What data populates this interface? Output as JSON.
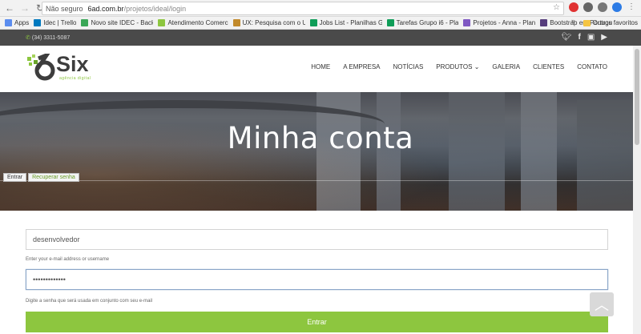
{
  "browser": {
    "security_label": "Não seguro",
    "url_host": "6ad.com.br",
    "url_path": "/projetos/ideal/login",
    "bookmarks": [
      {
        "label": "Apps",
        "color": "#5b8def"
      },
      {
        "label": "Idec | Trello",
        "color": "#0079bf"
      },
      {
        "label": "Novo site IDEC - Back",
        "color": "#3aa757"
      },
      {
        "label": "Atendimento Comerc",
        "color": "#8dc63f"
      },
      {
        "label": "UX: Pesquisa com o U",
        "color": "#c28a2b"
      },
      {
        "label": "Jobs List - Planilhas G",
        "color": "#0f9d58"
      },
      {
        "label": "Tarefas Grupo i6 - Pla",
        "color": "#0f9d58"
      },
      {
        "label": "Projetos - Anna - Plan",
        "color": "#7e57c2"
      },
      {
        "label": "Bootstrap em Portugu",
        "color": "#563d7c"
      }
    ],
    "bookmarks_more": "»",
    "other_bookmarks": "Outros favoritos"
  },
  "topbar": {
    "phone": "(34) 3311-5087",
    "social_icons": [
      "twitter-icon",
      "facebook-icon",
      "instagram-icon",
      "youtube-icon"
    ]
  },
  "logo": {
    "word": "Six",
    "tagline": "agência digital",
    "accent": "#8dc63f"
  },
  "menu": [
    {
      "label": "HOME"
    },
    {
      "label": "A EMPRESA"
    },
    {
      "label": "NOTÍCIAS"
    },
    {
      "label": "PRODUTOS ⌄"
    },
    {
      "label": "GALERIA"
    },
    {
      "label": "CLIENTES"
    },
    {
      "label": "CONTATO"
    }
  ],
  "hero": {
    "title": "Minha conta",
    "tabs": [
      {
        "label": "Entrar"
      },
      {
        "label": "Recuperar senha"
      }
    ]
  },
  "form": {
    "username_value": "desenvolvedor",
    "username_help": "Enter your e-mail address or username",
    "password_value": "•••••••••••••",
    "password_help": "Digite a senha que será usada em conjunto com seu e-mail",
    "submit_label": "Entrar"
  },
  "colors": {
    "brand_green": "#8dc63f",
    "topbar_bg": "#4a4a4a"
  }
}
